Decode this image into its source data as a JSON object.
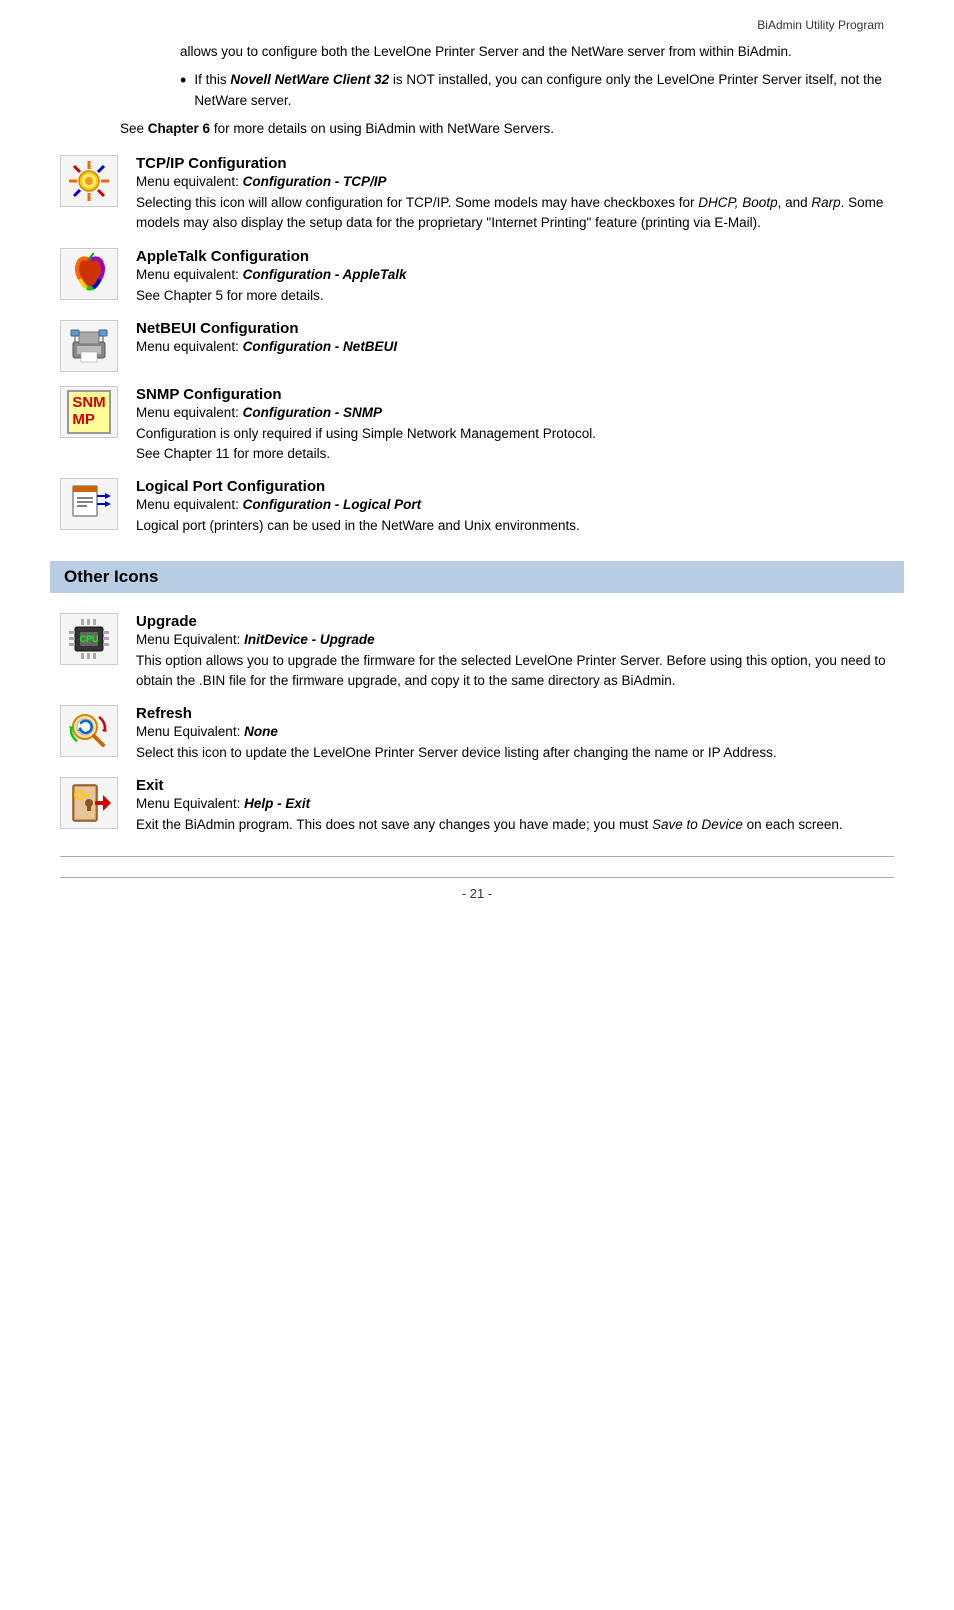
{
  "header": {
    "title": "BiAdmin Utility Program"
  },
  "intro": {
    "line1": "allows you to configure both the LevelOne Printer Server and the NetWare server from within BiAdmin.",
    "bullet": "If this ",
    "bullet_bold": "Novell NetWare Client 32",
    "bullet_rest": " is NOT installed, you can configure only the LevelOne Printer Server itself, not the NetWare server.",
    "see_chapter": "See ",
    "see_chapter_bold": "Chapter 6",
    "see_chapter_rest": " for more details on using BiAdmin with NetWare Servers."
  },
  "sections": [
    {
      "id": "tcpip",
      "title": "TCP/IP Configuration",
      "menu_equiv_prefix": "Menu equivalent: ",
      "menu_equiv_italic": "Configuration - TCP/IP",
      "description": "Selecting this icon will allow configuration for TCP/IP. Some models may have checkboxes for DHCP, Bootp, and Rarp. Some models may also display the setup data for the proprietary \"Internet Printing\" feature (printing via E-Mail).",
      "icon_label": "TCP/IP icon"
    },
    {
      "id": "appletalk",
      "title": "AppleTalk Configuration",
      "menu_equiv_prefix": "Menu equivalent: ",
      "menu_equiv_italic": "Configuration - AppleTalk",
      "description": "See Chapter 5 for more details.",
      "icon_label": "AppleTalk icon"
    },
    {
      "id": "netbeui",
      "title": "NetBEUI Configuration",
      "menu_equiv_prefix": "Menu equivalent: ",
      "menu_equiv_italic": "Configuration - NetBEUI",
      "description": "",
      "icon_label": "NetBEUI icon"
    },
    {
      "id": "snmp",
      "title": "SNMP Configuration",
      "menu_equiv_prefix": "Menu equivalent: ",
      "menu_equiv_italic": "Configuration - SNMP",
      "description": "Configuration is only required if using Simple Network Management Protocol.\nSee Chapter 11 for more details.",
      "icon_label": "SNMP icon"
    },
    {
      "id": "logical",
      "title": "Logical Port Configuration",
      "menu_equiv_prefix": "Menu equivalent: ",
      "menu_equiv_italic": "Configuration - Logical Port",
      "description": "Logical port (printers) can be used in the NetWare and Unix environments.",
      "icon_label": "Logical Port icon"
    }
  ],
  "other_icons_header": "Other Icons",
  "other_sections": [
    {
      "id": "upgrade",
      "title": "Upgrade",
      "menu_equiv_prefix": "Menu Equivalent: ",
      "menu_equiv_italic": "InitDevice - Upgrade",
      "description": "This option allows you to upgrade the firmware for the selected LevelOne Printer Server. Before using this option, you need to obtain the .BIN file for the firmware upgrade, and copy it to the same directory as BiAdmin.",
      "icon_label": "Upgrade icon"
    },
    {
      "id": "refresh",
      "title": "Refresh",
      "menu_equiv_prefix": "Menu Equivalent: ",
      "menu_equiv_italic": "None",
      "description": "Select this icon to update the LevelOne Printer Server device listing after changing the name or IP Address.",
      "icon_label": "Refresh icon"
    },
    {
      "id": "exit",
      "title": "Exit",
      "menu_equiv_prefix": "Menu Equivalent: ",
      "menu_equiv_italic": "Help - Exit",
      "description": "Exit the BiAdmin program. This does not save any changes you have made; you must Save to Device on each screen.",
      "icon_label": "Exit icon"
    }
  ],
  "page_number": "- 21 -"
}
